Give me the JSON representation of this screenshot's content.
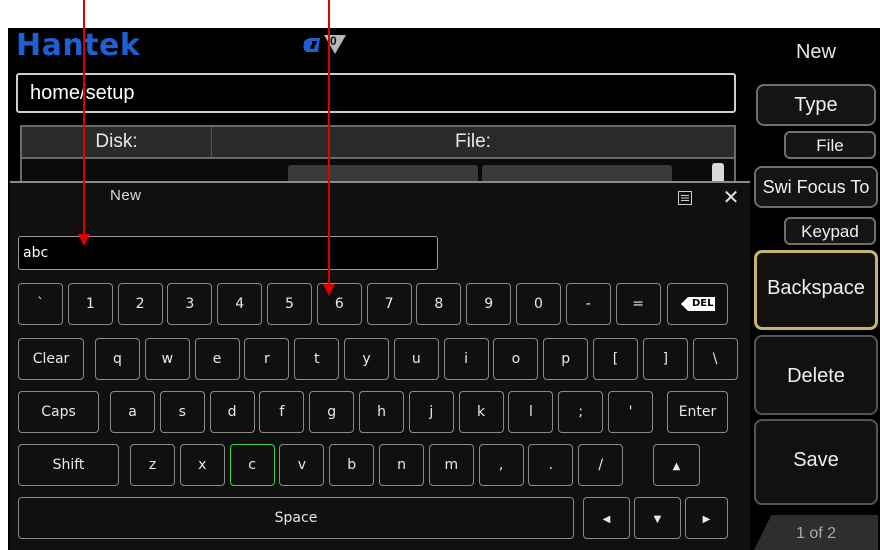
{
  "brand": {
    "logo": "Hantek",
    "badge_count": "0"
  },
  "path": {
    "value": "home/setup"
  },
  "file_browser": {
    "col_disk": "Disk:",
    "col_file": "File:"
  },
  "right_menu": {
    "title": "New",
    "type_label": "Type",
    "type_value": "File",
    "focus_label": "Swi Focus To",
    "focus_value": "Keypad",
    "backspace_label": "Backspace",
    "delete_label": "Delete",
    "save_label": "Save",
    "page_indicator": "1 of 2"
  },
  "dialog": {
    "title": "New",
    "close_glyph": "✕",
    "input_value": "abc"
  },
  "keyboard": {
    "row1": [
      "`",
      "1",
      "2",
      "3",
      "4",
      "5",
      "6",
      "7",
      "8",
      "9",
      "0",
      "-",
      "="
    ],
    "del_label": "DEL",
    "row2_start": "Clear",
    "row2": [
      "q",
      "w",
      "e",
      "r",
      "t",
      "y",
      "u",
      "i",
      "o",
      "p",
      "[",
      "]",
      "\\"
    ],
    "row3_start": "Caps",
    "row3": [
      "a",
      "s",
      "d",
      "f",
      "g",
      "h",
      "j",
      "k",
      "l",
      ";",
      "'"
    ],
    "row3_end": "Enter",
    "row4_start": "Shift",
    "row4": [
      "z",
      "x",
      "c",
      "v",
      "b",
      "n",
      "m",
      ",",
      ".",
      "/"
    ],
    "selected_key": "c",
    "space_label": "Space"
  },
  "colors": {
    "logo_blue": "#1f5fd6",
    "active_border": "#c9b36a",
    "selected_key_border": "#3fd14a",
    "annotation_red": "#e00000"
  }
}
